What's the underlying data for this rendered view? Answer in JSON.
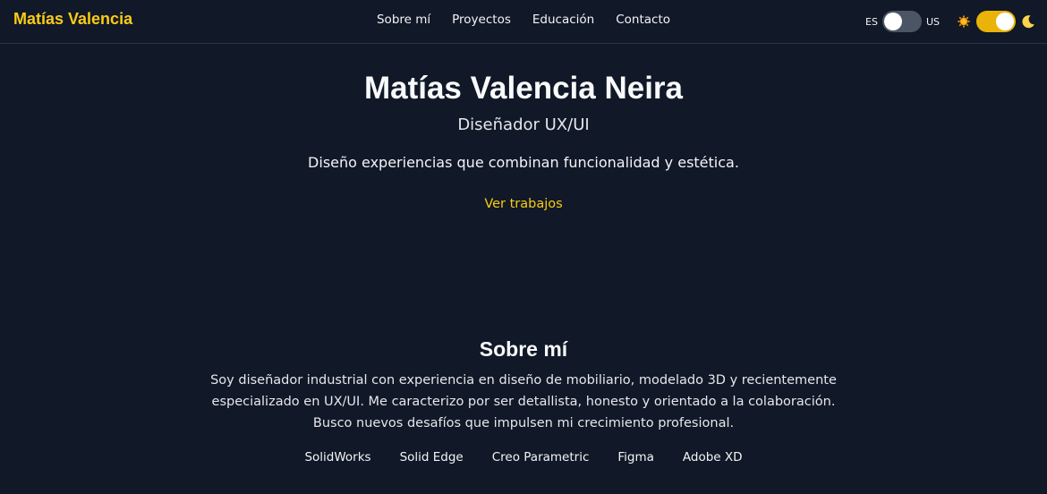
{
  "header": {
    "brand": "Matías Valencia",
    "nav": [
      "Sobre mí",
      "Proyectos",
      "Educación",
      "Contacto"
    ],
    "lang": {
      "left": "ES",
      "right": "US",
      "selected": "ES"
    },
    "theme": {
      "mode": "dark",
      "sun_icon": "sun-icon",
      "moon_icon": "moon-icon"
    }
  },
  "hero": {
    "title": "Matías Valencia Neira",
    "subtitle": "Diseñador UX/UI",
    "tagline": "Diseño experiencias que combinan funcionalidad y estética.",
    "cta": "Ver trabajos"
  },
  "about": {
    "title": "Sobre mí",
    "text": "Soy diseñador industrial con experiencia en diseño de mobiliario, modelado 3D y recientemente especializado en UX/UI. Me caracterizo por ser detallista, honesto y orientado a la colaboración. Busco nuevos desafíos que impulsen mi crecimiento profesional.",
    "skills": [
      "SolidWorks",
      "Solid Edge",
      "Creo Parametric",
      "Figma",
      "Adobe XD"
    ]
  },
  "colors": {
    "background": "#111827",
    "accent": "#facc15",
    "toggle_on": "#eab308",
    "toggle_off": "#4b5563"
  }
}
